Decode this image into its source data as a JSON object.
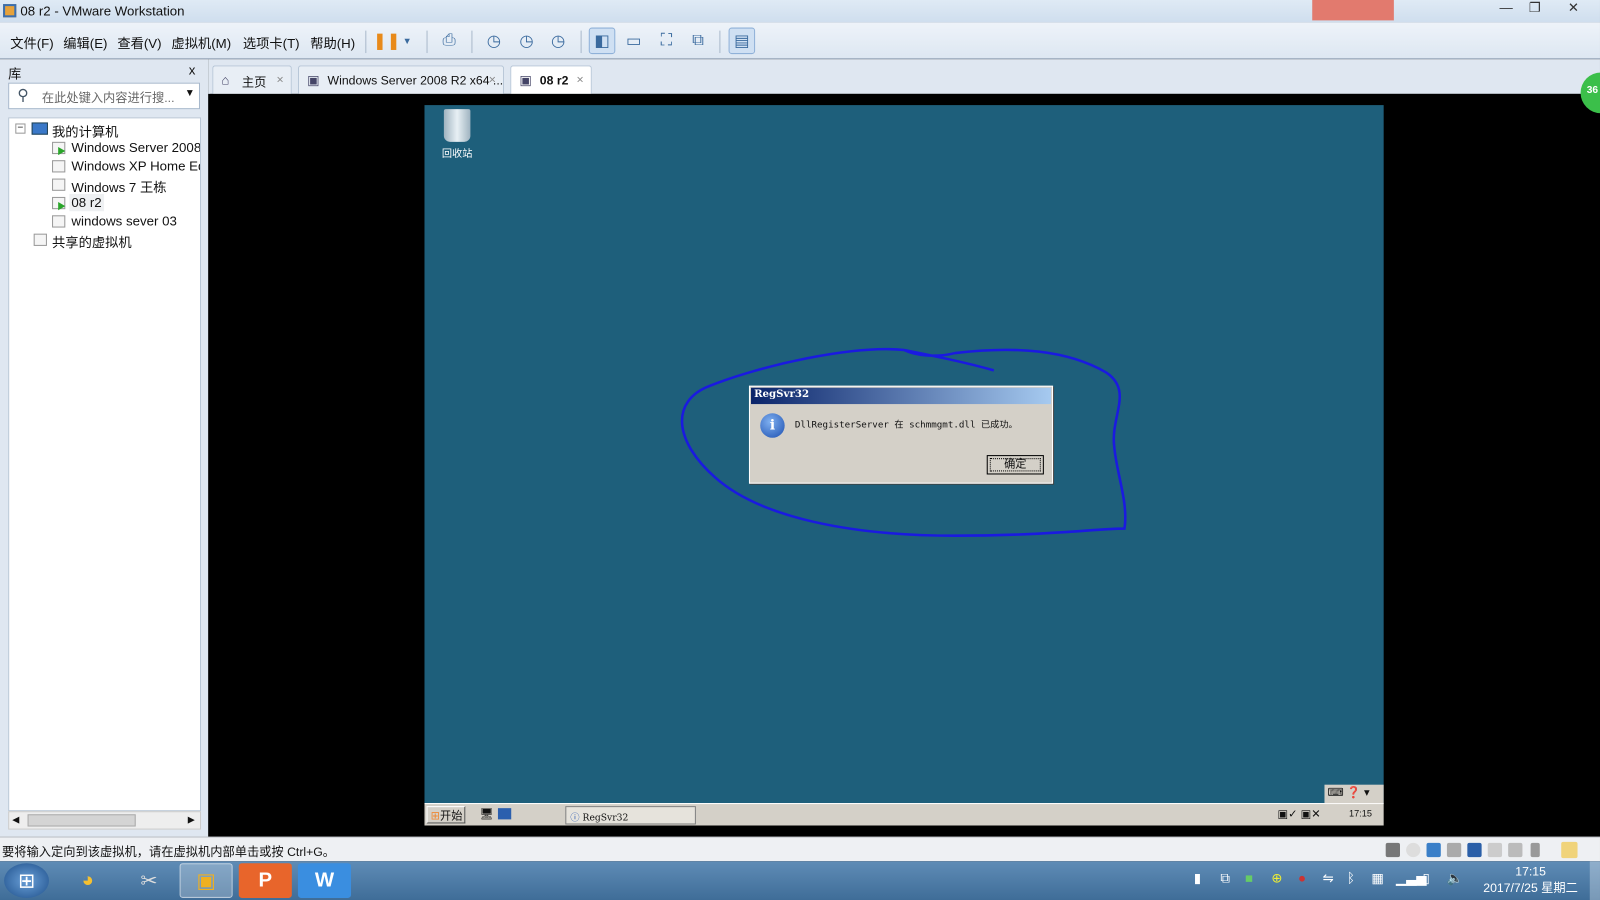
{
  "window": {
    "title": "08 r2 - VMware Workstation",
    "minimize": "—",
    "restore": "❐",
    "close": "✕"
  },
  "menu": [
    "文件(F)",
    "编辑(E)",
    "查看(V)",
    "虚拟机(M)",
    "选项卡(T)",
    "帮助(H)"
  ],
  "toolbar_icons": [
    "pause-icon",
    "dropdown-icon",
    "send-ctrl-alt-del-icon",
    "snapshot-take-icon",
    "snapshot-revert-icon",
    "snapshot-manager-icon",
    "show-library-icon",
    "console-view-icon",
    "fullscreen-icon",
    "unity-icon",
    "thumbnail-view-icon"
  ],
  "library": {
    "title": "库",
    "close": "x",
    "search_placeholder": "在此处键入内容进行搜...",
    "tree": {
      "root": "我的计算机",
      "vms": [
        {
          "label": "Windows Server 2008",
          "running": true
        },
        {
          "label": "Windows XP Home Edition",
          "running": false
        },
        {
          "label": "Windows 7 王栋",
          "running": false
        },
        {
          "label": "08 r2",
          "running": true,
          "selected": true
        },
        {
          "label": "windows sever 03",
          "running": false
        }
      ],
      "shared": "共享的虚拟机"
    }
  },
  "tabs": [
    {
      "label": "主页",
      "close": "×"
    },
    {
      "label": "Windows Server 2008 R2 x64 ...",
      "close": "×"
    },
    {
      "label": "08 r2",
      "close": "×",
      "active": true
    }
  ],
  "guest": {
    "recycle_bin": "回收站",
    "dialog": {
      "title": "RegSvr32",
      "message": "DllRegisterServer 在 schmmgmt.dll 已成功。",
      "ok": "确定"
    },
    "taskbar": {
      "start": "开始",
      "task": "RegSvr32",
      "time": "17:15"
    },
    "annotation_color": "#1a1ae0"
  },
  "side_badge": "36",
  "statusbar": {
    "hint": "要将输入定向到该虚拟机，请在虚拟机内部单击或按 Ctrl+G。"
  },
  "host_taskbar": {
    "time": "17:15",
    "date": "2017/7/25 星期二"
  }
}
